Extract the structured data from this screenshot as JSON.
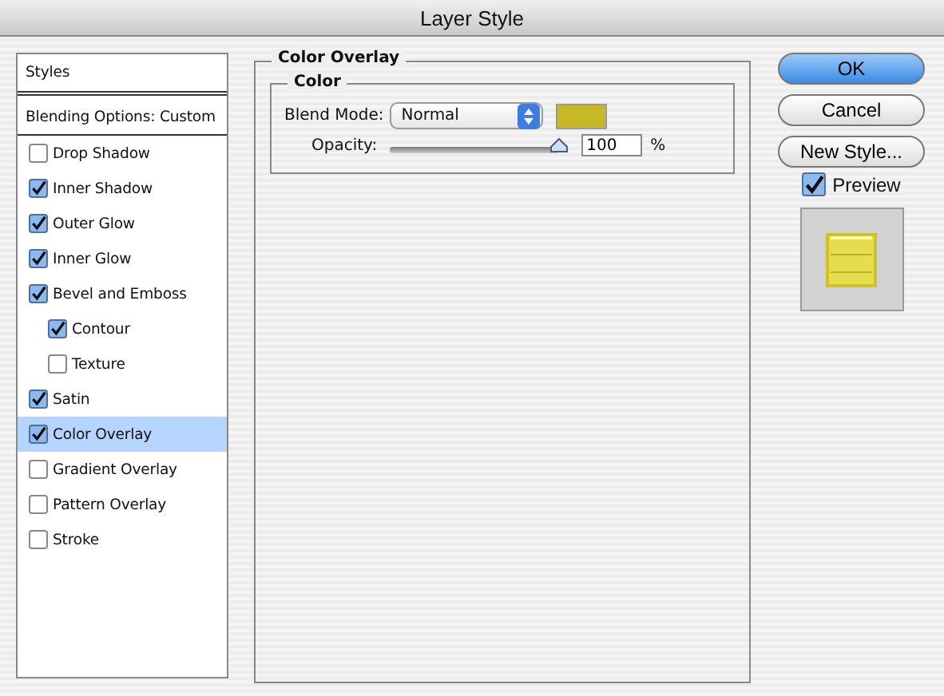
{
  "window": {
    "title": "Layer Style"
  },
  "styles_list": {
    "header": "Styles",
    "blending_options": "Blending Options: Custom",
    "items": [
      {
        "label": "Drop Shadow",
        "checked": false,
        "selected": false
      },
      {
        "label": "Inner Shadow",
        "checked": true,
        "selected": false
      },
      {
        "label": "Outer Glow",
        "checked": true,
        "selected": false
      },
      {
        "label": "Inner Glow",
        "checked": true,
        "selected": false
      },
      {
        "label": "Bevel and Emboss",
        "checked": true,
        "selected": false,
        "children": [
          {
            "label": "Contour",
            "checked": true,
            "selected": false
          },
          {
            "label": "Texture",
            "checked": false,
            "selected": false
          }
        ]
      },
      {
        "label": "Satin",
        "checked": true,
        "selected": false
      },
      {
        "label": "Color Overlay",
        "checked": true,
        "selected": true
      },
      {
        "label": "Gradient Overlay",
        "checked": false,
        "selected": false
      },
      {
        "label": "Pattern Overlay",
        "checked": false,
        "selected": false
      },
      {
        "label": "Stroke",
        "checked": false,
        "selected": false
      }
    ]
  },
  "panel": {
    "title": "Color Overlay",
    "group": "Color",
    "blend_mode_label": "Blend Mode:",
    "blend_mode": "Normal",
    "color": "#c9b826",
    "opacity_label": "Opacity:",
    "opacity": {
      "level": 1.0
    },
    "opacity_value": "100",
    "opacity_unit": "%"
  },
  "buttons": [
    {
      "label": "OK",
      "default": true
    },
    {
      "label": "Cancel",
      "default": false
    },
    {
      "label": "New Style...",
      "default": false
    }
  ],
  "preview": {
    "label": "Preview",
    "checked": true
  }
}
